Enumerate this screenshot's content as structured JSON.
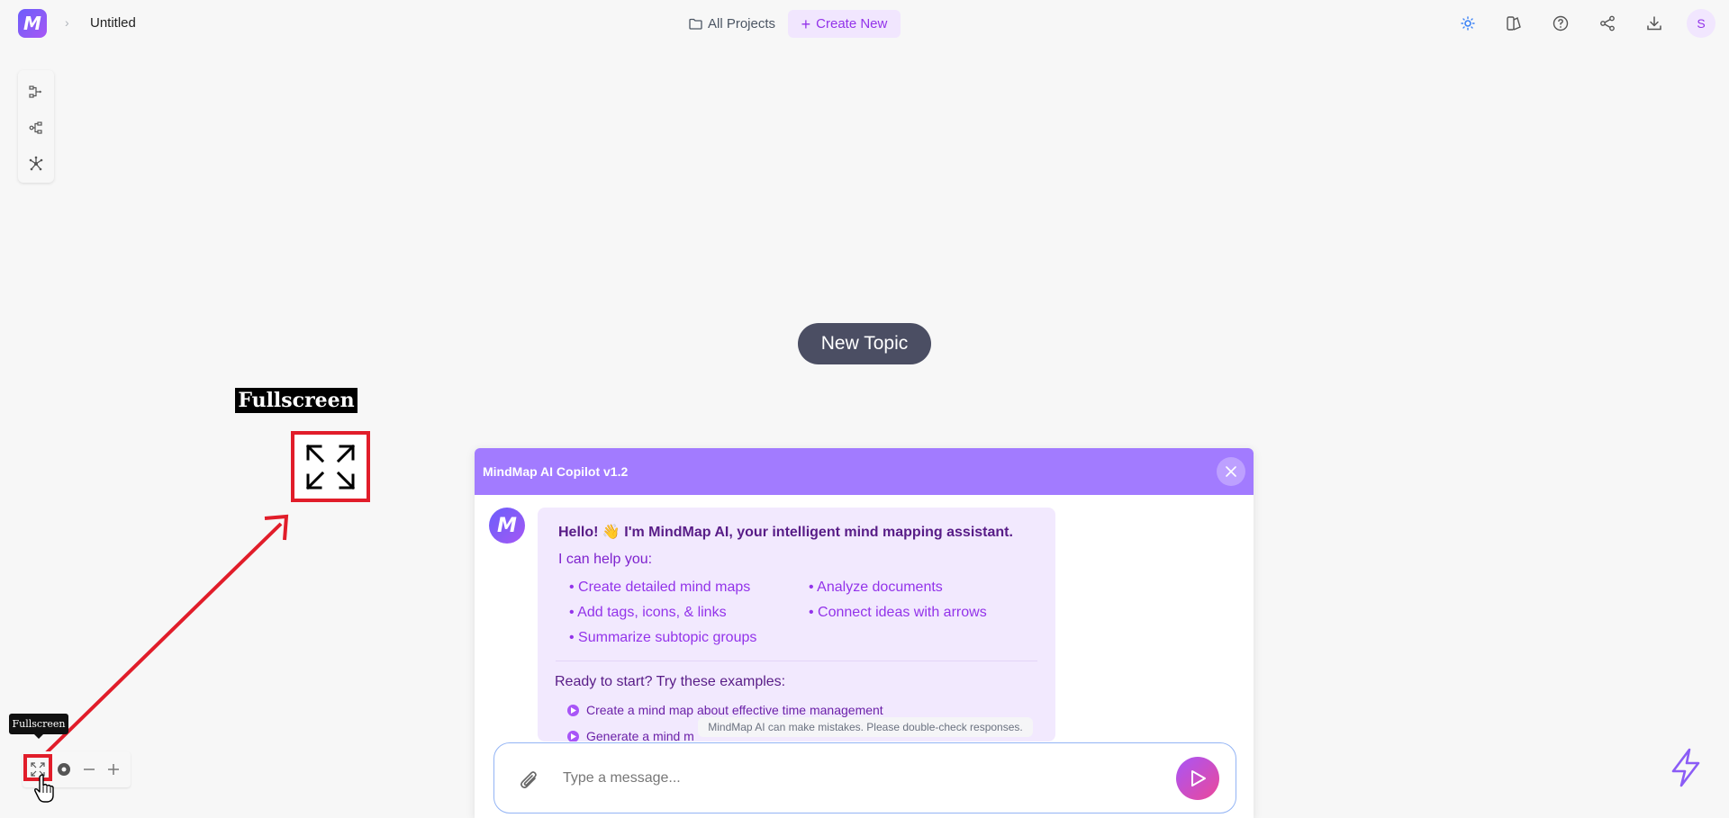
{
  "header": {
    "logo_icon": "mindmap-logo",
    "doc_title": "Untitled",
    "all_projects_label": "All Projects",
    "create_new_label": "Create New",
    "avatar_initial": "S",
    "icons": [
      "sun-icon",
      "theme-icon",
      "help-icon",
      "share-icon",
      "download-icon"
    ]
  },
  "layout_toolbar": {
    "icons": [
      "layout-right-icon",
      "layout-left-right-icon",
      "layout-radial-icon"
    ]
  },
  "canvas": {
    "topic_label": "New Topic"
  },
  "annotation": {
    "label": "Fullscreen",
    "accent_color": "#e11d2a"
  },
  "copilot": {
    "title": "MindMap AI Copilot v1.2",
    "greeting": "Hello! 👋 I'm MindMap AI, your intelligent mind mapping assistant.",
    "can_help": "I can help you:",
    "capabilities": [
      "• Create detailed mind maps",
      "• Analyze documents",
      "• Add tags, icons, & links",
      "• Connect ideas with arrows",
      "• Summarize subtopic groups"
    ],
    "ready_prompt": "Ready to start? Try these examples:",
    "examples": [
      "Create a mind map about effective time management",
      "Generate a mind m"
    ],
    "disclaimer": "MindMap AI can make mistakes. Please double-check responses.",
    "input_placeholder": "Type a message...",
    "header_color": "#a27bff"
  },
  "bottom_controls": {
    "tooltip": "Fullscreen",
    "icons": [
      "fullscreen-icon",
      "locate-icon",
      "zoom-out-icon",
      "zoom-in-icon"
    ]
  }
}
